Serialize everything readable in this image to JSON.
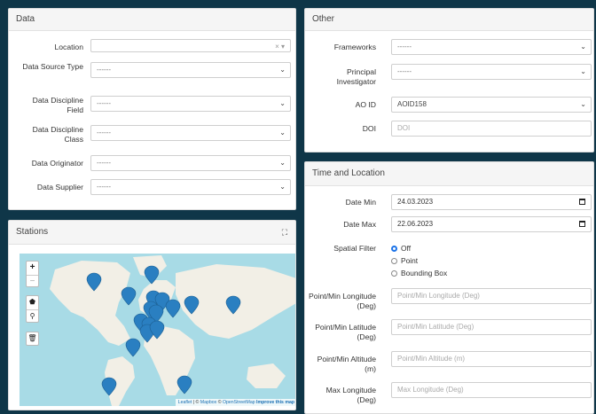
{
  "data_panel": {
    "title": "Data",
    "fields": [
      {
        "label": "Location",
        "value": "",
        "kind": "multiselect"
      },
      {
        "label": "Data Source Type",
        "value": "------",
        "kind": "select"
      },
      {
        "label": "Data Discipline Field",
        "value": "------",
        "kind": "select"
      },
      {
        "label": "Data Discipline Class",
        "value": "------",
        "kind": "select"
      },
      {
        "label": "Data Originator",
        "value": "------",
        "kind": "select"
      },
      {
        "label": "Data Supplier",
        "value": "------",
        "kind": "select"
      }
    ]
  },
  "other_panel": {
    "title": "Other",
    "fields": [
      {
        "label": "Frameworks",
        "value": "------",
        "kind": "select"
      },
      {
        "label": "Principal Investigator",
        "value": "------",
        "kind": "select"
      },
      {
        "label": "AO ID",
        "value": "AOID158",
        "kind": "select"
      },
      {
        "label": "DOI",
        "placeholder": "DOI",
        "kind": "input"
      }
    ]
  },
  "stations_panel": {
    "title": "Stations",
    "expand_icon": "expand-icon",
    "map_controls": {
      "zoom_in": "+",
      "zoom_out": "−",
      "draw_polygon_icon": "polygon-icon",
      "draw_marker_icon": "marker-icon",
      "delete_icon": "trash-icon"
    },
    "attribution": {
      "leaflet": "Leaflet",
      "sep1": " | © ",
      "mapbox": "Mapbox",
      "sep2": " © ",
      "osm": "OpenStreetMap",
      "improve": "Improve this map"
    },
    "marker_color": "#2a7fc1",
    "station_count": 17
  },
  "time_location_panel": {
    "title": "Time and Location",
    "date_min": {
      "label": "Date Min",
      "value": "24.03.2023"
    },
    "date_max": {
      "label": "Date Max",
      "value": "22.06.2023"
    },
    "spatial_filter": {
      "label": "Spatial Filter",
      "options": [
        "Off",
        "Point",
        "Bounding Box"
      ],
      "selected": "Off"
    },
    "inputs": [
      {
        "label": "Point/Min Longitude (Deg)",
        "placeholder": "Point/Min Longitude (Deg)"
      },
      {
        "label": "Point/Min Latitude (Deg)",
        "placeholder": "Point/Min Latitude (Deg)"
      },
      {
        "label": "Point/Min Altitude (m)",
        "placeholder": "Point/Min Altitude (m)"
      },
      {
        "label": "Max Longitude (Deg)",
        "placeholder": "Max Longitude (Deg)"
      }
    ]
  },
  "colors": {
    "page_background": "#0f3648",
    "accent": "#1b73e8",
    "map_water": "#a8dbe6",
    "map_land": "#f2efe6"
  }
}
